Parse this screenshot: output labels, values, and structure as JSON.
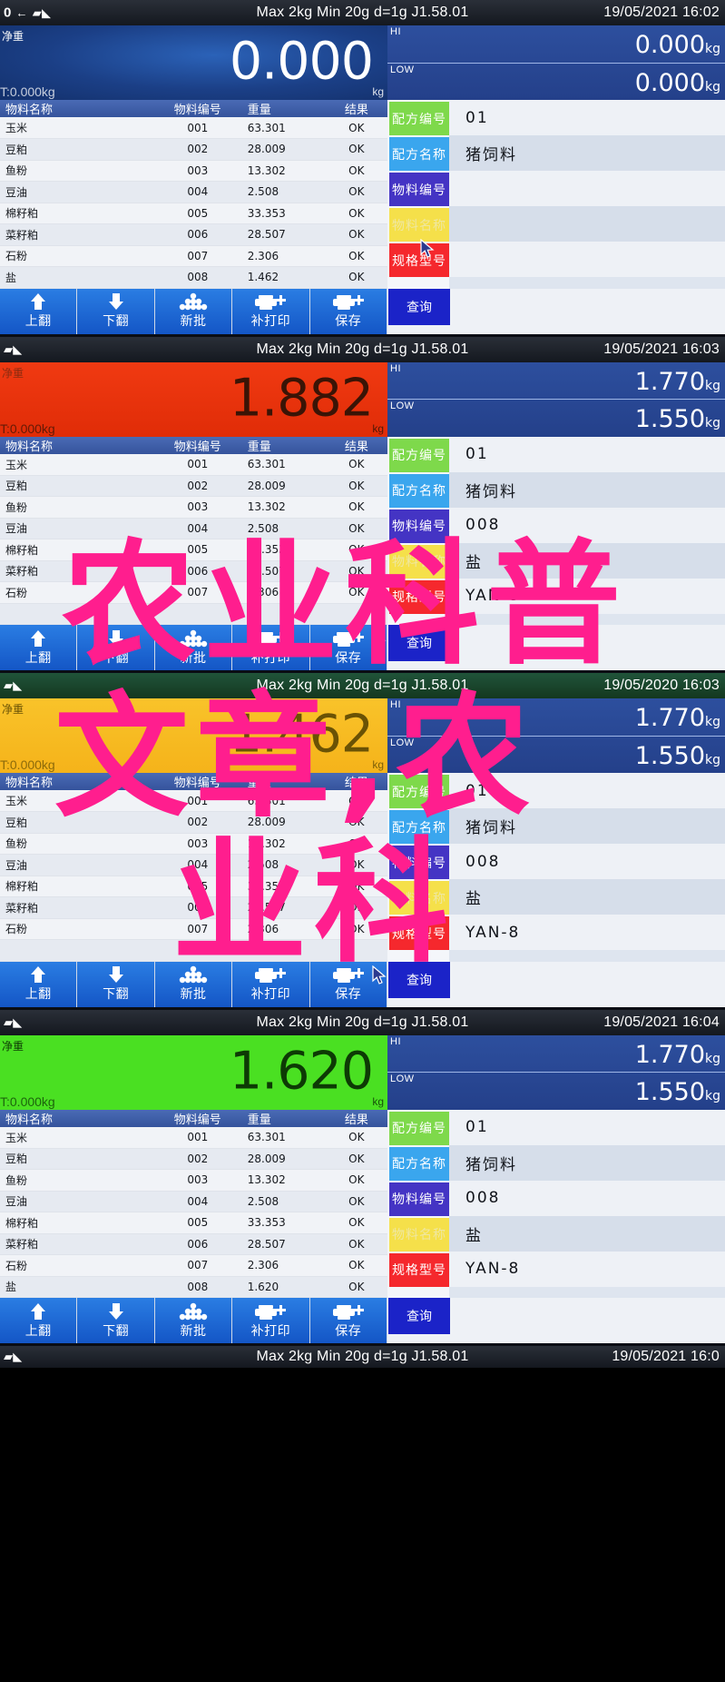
{
  "device": {
    "spec_line": "Max 2kg  Min 20g  d=1g    J1.58.01",
    "status_icons": {
      "zero": "0",
      "arrow": "←",
      "stable": "▰◣"
    }
  },
  "table": {
    "headers": [
      "物料名称",
      "物料编号",
      "重量",
      "结果"
    ],
    "rows": [
      {
        "name": "玉米",
        "code": "001",
        "weight": "63.301",
        "result": "OK"
      },
      {
        "name": "豆粕",
        "code": "002",
        "weight": "28.009",
        "result": "OK"
      },
      {
        "name": "鱼粉",
        "code": "003",
        "weight": "13.302",
        "result": "OK"
      },
      {
        "name": "豆油",
        "code": "004",
        "weight": "2.508",
        "result": "OK"
      },
      {
        "name": "棉籽粕",
        "code": "005",
        "weight": "33.353",
        "result": "OK"
      },
      {
        "name": "菜籽粕",
        "code": "006",
        "weight": "28.507",
        "result": "OK"
      },
      {
        "name": "石粉",
        "code": "007",
        "weight": "2.306",
        "result": "OK"
      },
      {
        "name": "盐",
        "code": "008",
        "weight": "1.462",
        "result": "OK"
      }
    ],
    "rows_last": [
      {
        "name": "玉米",
        "code": "001",
        "weight": "63.301",
        "result": "OK"
      },
      {
        "name": "豆粕",
        "code": "002",
        "weight": "28.009",
        "result": "OK"
      },
      {
        "name": "鱼粉",
        "code": "003",
        "weight": "13.302",
        "result": "OK"
      },
      {
        "name": "豆油",
        "code": "004",
        "weight": "2.508",
        "result": "OK"
      },
      {
        "name": "棉籽粕",
        "code": "005",
        "weight": "33.353",
        "result": "OK"
      },
      {
        "name": "菜籽粕",
        "code": "006",
        "weight": "28.507",
        "result": "OK"
      },
      {
        "name": "石粉",
        "code": "007",
        "weight": "2.306",
        "result": "OK"
      },
      {
        "name": "盐",
        "code": "008",
        "weight": "1.620",
        "result": "OK"
      }
    ]
  },
  "keys": {
    "recipe_no": {
      "label": "配方编号",
      "color": "#7ed94b"
    },
    "recipe_name": {
      "label": "配方名称",
      "color": "#3aa6ee"
    },
    "material_no": {
      "label": "物料编号",
      "color": "#4434c4"
    },
    "material_name": {
      "label": "物料名称",
      "color": "#f5e04a"
    },
    "spec_model": {
      "label": "规格型号",
      "color": "#f5282d"
    },
    "query": {
      "label": "查询",
      "color": "#1b23c8"
    }
  },
  "toolbar": {
    "page_up": {
      "label": "上翻",
      "icon": "arrow-up-icon"
    },
    "page_down": {
      "label": "下翻",
      "icon": "arrow-down-icon"
    },
    "new_batch": {
      "label": "新批",
      "icon": "stack-dots-icon"
    },
    "reprint": {
      "label": "补打印",
      "icon": "printer-plus-icon"
    },
    "save": {
      "label": "保存",
      "icon": "printer-plus-icon"
    }
  },
  "labels": {
    "net": "净重",
    "tare": "T:0.000kg",
    "unit": "kg",
    "hi": "HI",
    "low": "LOW"
  },
  "panels": [
    {
      "id": "panel-1",
      "datetime": "19/05/2021 16:02",
      "statusbar_color": "dark",
      "display_color": "blue",
      "weight": "0.000",
      "hi": "0.000",
      "low": "0.000",
      "recipe_no": "01",
      "recipe_name": "猪饲料",
      "material_no": "",
      "material_name": "",
      "spec_model": "",
      "cursor_on": "material-name-key"
    },
    {
      "id": "panel-2",
      "datetime": "19/05/2021 16:03",
      "statusbar_color": "dark",
      "display_color": "red",
      "weight": "1.882",
      "hi": "1.770",
      "low": "1.550",
      "recipe_no": "01",
      "recipe_name": "猪饲料",
      "material_no": "008",
      "material_name": "盐",
      "spec_model": "YAN-8",
      "cursor_on": "save-button"
    },
    {
      "id": "panel-3",
      "datetime": "19/05/2020 16:03",
      "statusbar_color": "green",
      "display_color": "yellow",
      "weight": "1.462",
      "hi": "1.770",
      "low": "1.550",
      "recipe_no": "01",
      "recipe_name": "猪饲料",
      "material_no": "008",
      "material_name": "盐",
      "spec_model": "YAN-8",
      "cursor_on": "save-button"
    },
    {
      "id": "panel-4",
      "datetime": "19/05/2021 16:04",
      "statusbar_color": "dark",
      "display_color": "green",
      "weight": "1.620",
      "hi": "1.770",
      "low": "1.550",
      "recipe_no": "01",
      "recipe_name": "猪饲料",
      "material_no": "008",
      "material_name": "盐",
      "spec_model": "YAN-8",
      "cursor_on": "none"
    }
  ],
  "footer_statusbar": {
    "datetime": "19/05/2021 16:0",
    "spec_line": "Max 2kg  Min 20g  d=1g    J1.58.01"
  },
  "overlay": {
    "color": "#ff1e8e",
    "line1": "农业科普",
    "line2": "文章,农",
    "line3": "业科"
  }
}
